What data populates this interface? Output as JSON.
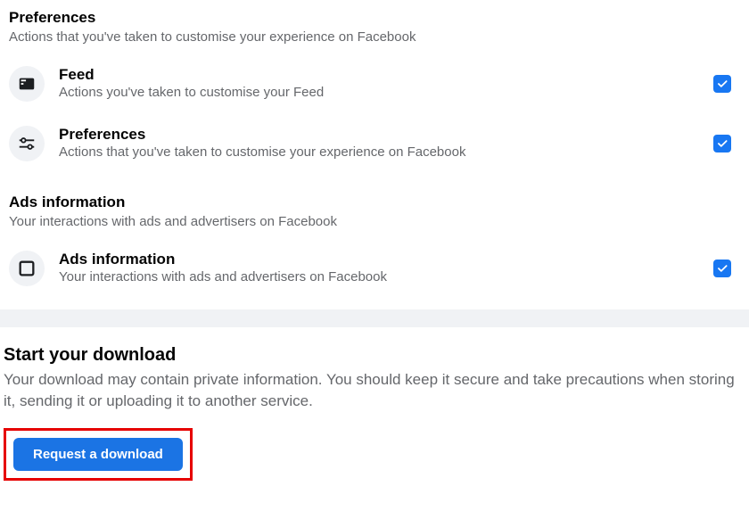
{
  "sections": [
    {
      "title": "Preferences",
      "desc": "Actions that you've taken to customise your experience on Facebook",
      "items": [
        {
          "title": "Feed",
          "desc": "Actions you've taken to customise your Feed"
        },
        {
          "title": "Preferences",
          "desc": "Actions that you've taken to customise your experience on Facebook"
        }
      ]
    },
    {
      "title": "Ads information",
      "desc": "Your interactions with ads and advertisers on Facebook",
      "items": [
        {
          "title": "Ads information",
          "desc": "Your interactions with ads and advertisers on Facebook"
        }
      ]
    }
  ],
  "download": {
    "title": "Start your download",
    "desc": "Your download may contain private information. You should keep it secure and take precautions when storing it, sending it or uploading it to another service.",
    "button": "Request a download"
  }
}
